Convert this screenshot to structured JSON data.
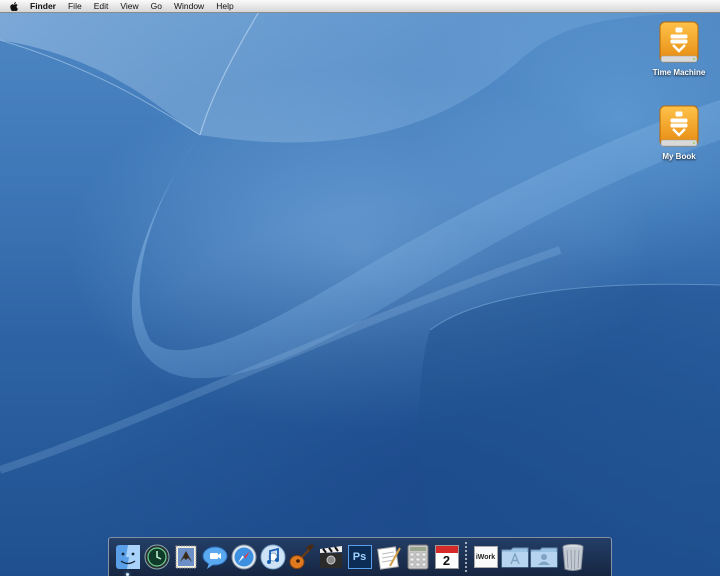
{
  "menubar": {
    "apple_icon": "apple-logo-icon",
    "app_name": "Finder",
    "items": [
      "File",
      "Edit",
      "View",
      "Go",
      "Window",
      "Help"
    ]
  },
  "desktop": {
    "icons": [
      {
        "label": "Time Machine",
        "icon": "external-firewire-drive-icon",
        "color": "#f0a020"
      },
      {
        "label": "My Book",
        "icon": "external-firewire-drive-icon",
        "color": "#f0a020"
      }
    ]
  },
  "dock": {
    "items": [
      {
        "name": "finder",
        "icon": "finder-icon",
        "running": true
      },
      {
        "name": "time-machine",
        "icon": "time-machine-icon",
        "running": false
      },
      {
        "name": "mail",
        "icon": "mail-stamp-icon",
        "running": false
      },
      {
        "name": "ichat",
        "icon": "ichat-bubble-icon",
        "running": false
      },
      {
        "name": "safari",
        "icon": "safari-compass-icon",
        "running": false
      },
      {
        "name": "itunes",
        "icon": "itunes-icon",
        "running": false
      },
      {
        "name": "garageband",
        "icon": "garageband-guitar-icon",
        "running": false
      },
      {
        "name": "final-cut",
        "icon": "clapperboard-icon",
        "running": false
      },
      {
        "name": "photoshop",
        "icon": "photoshop-icon",
        "text": "Ps",
        "running": false
      },
      {
        "name": "textedit",
        "icon": "textedit-icon",
        "running": false
      },
      {
        "name": "calculator",
        "icon": "calculator-icon",
        "running": false
      },
      {
        "name": "ical",
        "icon": "calendar-icon",
        "text": "2",
        "running": false
      },
      {
        "name": "iwork",
        "icon": "iwork-folder-icon",
        "text": "iWork",
        "running": false
      },
      {
        "name": "applications",
        "icon": "applications-folder-icon",
        "running": false
      },
      {
        "name": "documents",
        "icon": "user-folder-icon",
        "running": false
      },
      {
        "name": "trash",
        "icon": "trash-icon",
        "running": false
      }
    ]
  },
  "colors": {
    "menubar_bg": "#e8e8e8",
    "drive_orange": "#f0a020",
    "wallpaper_blue": "#2d63a4"
  }
}
